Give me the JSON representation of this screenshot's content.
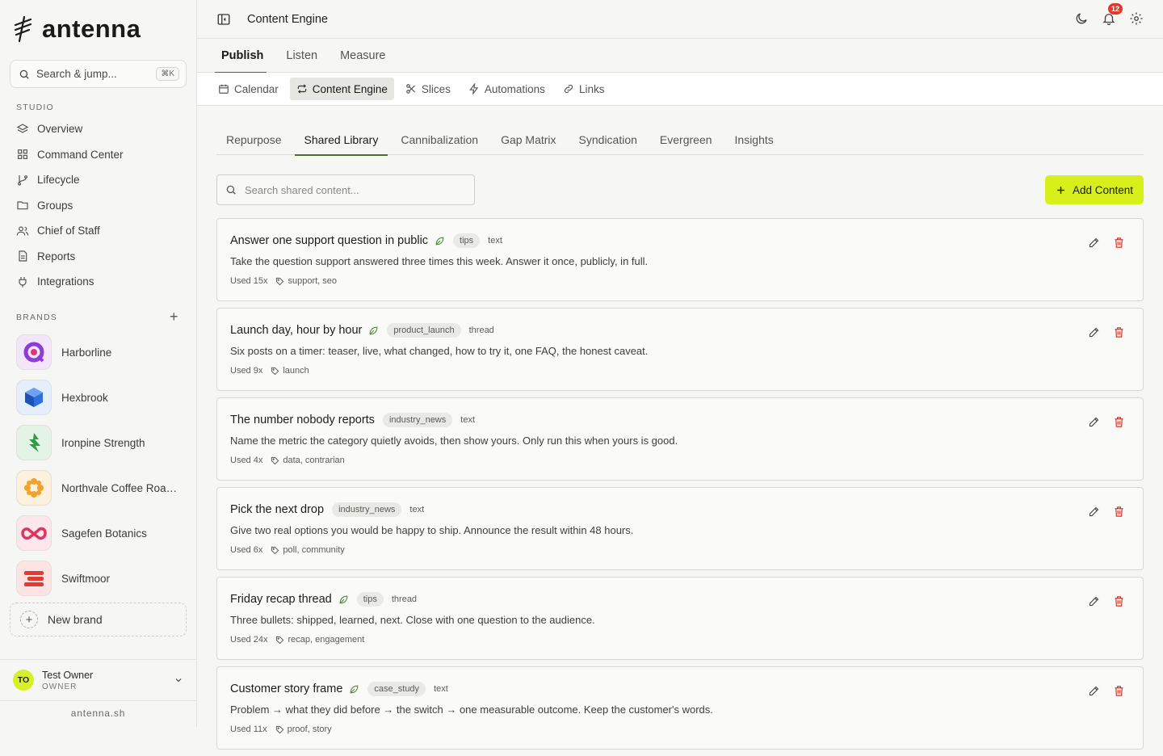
{
  "app": {
    "name": "antenna",
    "domain": "antenna.sh"
  },
  "sidebar": {
    "search": {
      "label": "Search & jump...",
      "shortcut": "⌘K"
    },
    "studio_label": "STUDIO",
    "nav": [
      {
        "label": "Overview",
        "icon": "layers-icon"
      },
      {
        "label": "Command Center",
        "icon": "grid-icon"
      },
      {
        "label": "Lifecycle",
        "icon": "branch-icon"
      },
      {
        "label": "Groups",
        "icon": "folder-icon"
      },
      {
        "label": "Chief of Staff",
        "icon": "users-icon"
      },
      {
        "label": "Reports",
        "icon": "document-icon"
      },
      {
        "label": "Integrations",
        "icon": "plug-icon"
      }
    ],
    "brands_label": "BRANDS",
    "brands": [
      {
        "name": "Harborline",
        "bg": "#f3e6fb",
        "color": "#8b3dd6"
      },
      {
        "name": "Hexbrook",
        "bg": "#e5eefc",
        "color": "#2f6fe0"
      },
      {
        "name": "Ironpine Strength",
        "bg": "#e3f3e6",
        "color": "#2f9a48"
      },
      {
        "name": "Northvale Coffee Roasters",
        "bg": "#fdf0dc",
        "color": "#f2a12b"
      },
      {
        "name": "Sagefen Botanics",
        "bg": "#fde6ec",
        "color": "#e0335d"
      },
      {
        "name": "Swiftmoor",
        "bg": "#fde4e2",
        "color": "#e23b33"
      }
    ],
    "new_brand": "New brand",
    "user": {
      "initials": "TO",
      "name": "Test Owner",
      "role": "OWNER"
    }
  },
  "topbar": {
    "title": "Content Engine",
    "notifications": "12"
  },
  "tabs_primary": [
    {
      "label": "Publish",
      "active": true
    },
    {
      "label": "Listen",
      "active": false
    },
    {
      "label": "Measure",
      "active": false
    }
  ],
  "tabs_secondary": [
    {
      "label": "Calendar",
      "icon": "calendar-icon",
      "active": false
    },
    {
      "label": "Content Engine",
      "icon": "repeat-icon",
      "active": true
    },
    {
      "label": "Slices",
      "icon": "scissors-icon",
      "active": false
    },
    {
      "label": "Automations",
      "icon": "bolt-icon",
      "active": false
    },
    {
      "label": "Links",
      "icon": "link-icon",
      "active": false
    }
  ],
  "tabs_tertiary": [
    {
      "label": "Repurpose",
      "active": false
    },
    {
      "label": "Shared Library",
      "active": true
    },
    {
      "label": "Cannibalization",
      "active": false
    },
    {
      "label": "Gap Matrix",
      "active": false
    },
    {
      "label": "Syndication",
      "active": false
    },
    {
      "label": "Evergreen",
      "active": false
    },
    {
      "label": "Insights",
      "active": false
    }
  ],
  "library": {
    "search_placeholder": "Search shared content...",
    "add_button": "Add Content",
    "items": [
      {
        "title": "Answer one support question in public",
        "evergreen": true,
        "category": "tips",
        "type": "text",
        "description": "Take the question support answered three times this week. Answer it once, publicly, in full.",
        "used": "Used 15x",
        "tags": "support, seo"
      },
      {
        "title": "Launch day, hour by hour",
        "evergreen": true,
        "category": "product_launch",
        "type": "thread",
        "description": "Six posts on a timer: teaser, live, what changed, how to try it, one FAQ, the honest caveat.",
        "used": "Used 9x",
        "tags": "launch"
      },
      {
        "title": "The number nobody reports",
        "evergreen": false,
        "category": "industry_news",
        "type": "text",
        "description": "Name the metric the category quietly avoids, then show yours. Only run this when yours is good.",
        "used": "Used 4x",
        "tags": "data, contrarian"
      },
      {
        "title": "Pick the next drop",
        "evergreen": false,
        "category": "industry_news",
        "type": "text",
        "description": "Give two real options you would be happy to ship. Announce the result within 48 hours.",
        "used": "Used 6x",
        "tags": "poll, community"
      },
      {
        "title": "Friday recap thread",
        "evergreen": true,
        "category": "tips",
        "type": "thread",
        "description": "Three bullets: shipped, learned, next. Close with one question to the audience.",
        "used": "Used 24x",
        "tags": "recap, engagement"
      },
      {
        "title": "Customer story frame",
        "evergreen": true,
        "category": "case_study",
        "type": "text",
        "description": "Problem → what they did before → the switch → one measurable outcome. Keep the customer's words.",
        "used": "Used 11x",
        "tags": "proof, story"
      }
    ]
  },
  "colors": {
    "accent": "#d7f01c",
    "active_underline": "#4d6b2e",
    "danger": "#d6332a",
    "evergreen": "#4e8a3a"
  }
}
